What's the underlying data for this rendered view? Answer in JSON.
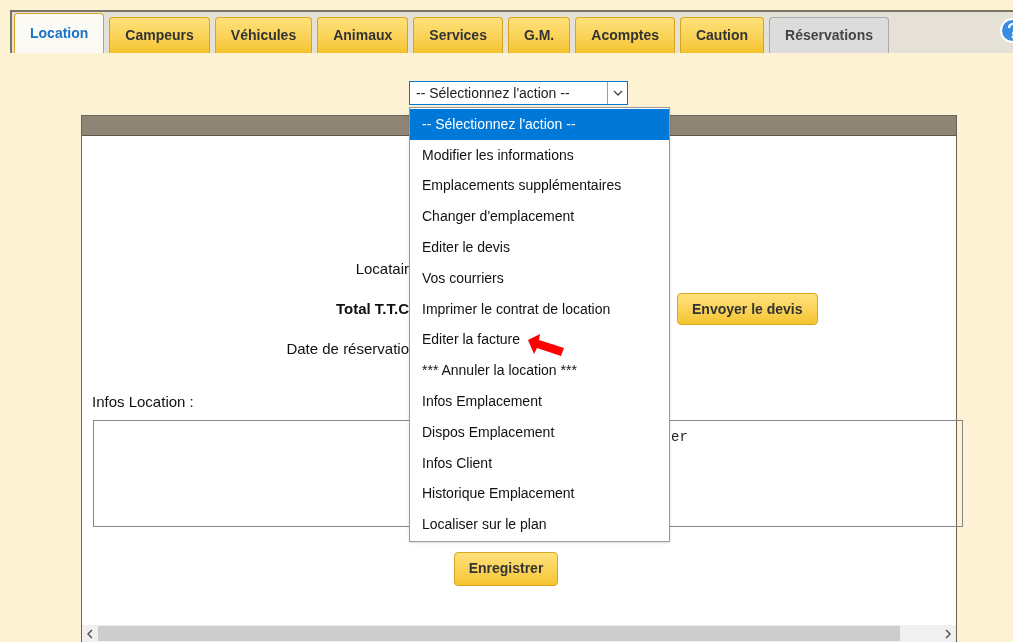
{
  "tabs": [
    {
      "label": "Location",
      "selected": true,
      "kind": "main"
    },
    {
      "label": "Campeurs",
      "selected": false,
      "kind": "main"
    },
    {
      "label": "Véhicules",
      "selected": false,
      "kind": "main"
    },
    {
      "label": "Animaux",
      "selected": false,
      "kind": "main"
    },
    {
      "label": "Services",
      "selected": false,
      "kind": "main"
    },
    {
      "label": "G.M.",
      "selected": false,
      "kind": "main"
    },
    {
      "label": "Acomptes",
      "selected": false,
      "kind": "main"
    },
    {
      "label": "Caution",
      "selected": false,
      "kind": "main"
    },
    {
      "label": "Réservations",
      "selected": false,
      "kind": "other"
    }
  ],
  "action_select": {
    "value": "-- Sélectionnez l'action --",
    "expanded": true,
    "options": [
      {
        "label": "-- Sélectionnez l'action --",
        "selected": true
      },
      {
        "label": "Modifier les informations",
        "selected": false
      },
      {
        "label": "Emplacements supplémentaires",
        "selected": false
      },
      {
        "label": "Changer d'emplacement",
        "selected": false
      },
      {
        "label": "Editer le devis",
        "selected": false
      },
      {
        "label": "Vos courriers",
        "selected": false
      },
      {
        "label": "Imprimer le contrat de location",
        "selected": false
      },
      {
        "label": "Editer la facture",
        "selected": false
      },
      {
        "label": "*** Annuler la location ***",
        "selected": false
      },
      {
        "label": "Infos Emplacement",
        "selected": false
      },
      {
        "label": "Dispos Emplacement",
        "selected": false
      },
      {
        "label": "Infos Client",
        "selected": false
      },
      {
        "label": "Historique Emplacement",
        "selected": false
      },
      {
        "label": "Localiser sur le plan",
        "selected": false
      }
    ]
  },
  "form": {
    "rows": [
      {
        "label": "Locatair",
        "bold": false
      },
      {
        "label": "Total T.T.C",
        "bold": true
      },
      {
        "label": "Date de réservatio",
        "bold": false
      }
    ],
    "send_quote_button": "Envoyer le devis",
    "infos_label": "Infos Location :",
    "infos_value": "er",
    "save_button": "Enregistrer"
  }
}
